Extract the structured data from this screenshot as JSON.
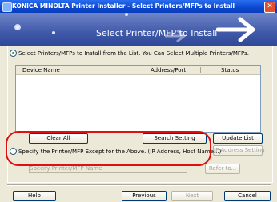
{
  "window": {
    "title": "KONICA MINOLTA Printer Installer - Select Printers/MFPs to Install",
    "close_glyph": "✕"
  },
  "banner": {
    "heading": "Select Printer/MFP to Install"
  },
  "option_list": {
    "label": "Select Printers/MFPs to Install from the List. You Can Select Multiple Printers/MFPs.",
    "selected": true
  },
  "device_list": {
    "columns": [
      "Device Name",
      "Address/Port",
      "Status"
    ],
    "rows": []
  },
  "list_buttons": {
    "clear_all": "Clear All",
    "search_setting": "Search Setting",
    "update_list": "Update List",
    "ip_address_setting": "IP Address Setting"
  },
  "option_specify": {
    "label": "Specify the Printer/MFP Except for the Above. (IP Address, Host Name...)",
    "selected": false,
    "field_placeholder": "Specify Printer/MFP Name",
    "refer_button": "Refer to..."
  },
  "footer": {
    "help": "Help",
    "previous": "Previous",
    "next": "Next",
    "cancel": "Cancel"
  },
  "colors": {
    "titlebar": "#0a48d0",
    "banner": "#3f58a8",
    "highlight": "#e01010"
  }
}
